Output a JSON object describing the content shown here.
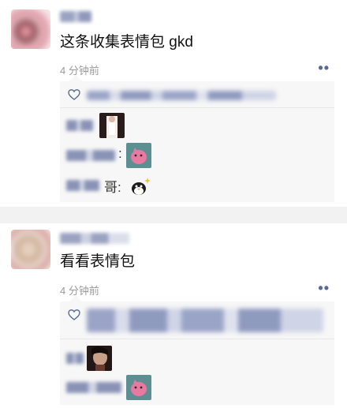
{
  "posts": [
    {
      "content": "这条收集表情包 gkd",
      "time": "4 分钟前",
      "more": "••",
      "comments": [
        {
          "sticker": "photo-sticker"
        },
        {
          "colon": ":",
          "sticker": "pink-cat-sticker"
        },
        {
          "colon": "哥:",
          "sticker": "penguin-sticker"
        }
      ]
    },
    {
      "content": "看看表情包",
      "time": "4 分钟前",
      "more": "••",
      "comments": [
        {
          "sticker": "dark-photo-sticker"
        },
        {
          "sticker": "pink-cat-sticker"
        }
      ]
    }
  ],
  "colors": {
    "name": "#576b95",
    "panel": "#f7f7f7",
    "separator": "#f2f2f2",
    "time": "#9a9a9a"
  }
}
